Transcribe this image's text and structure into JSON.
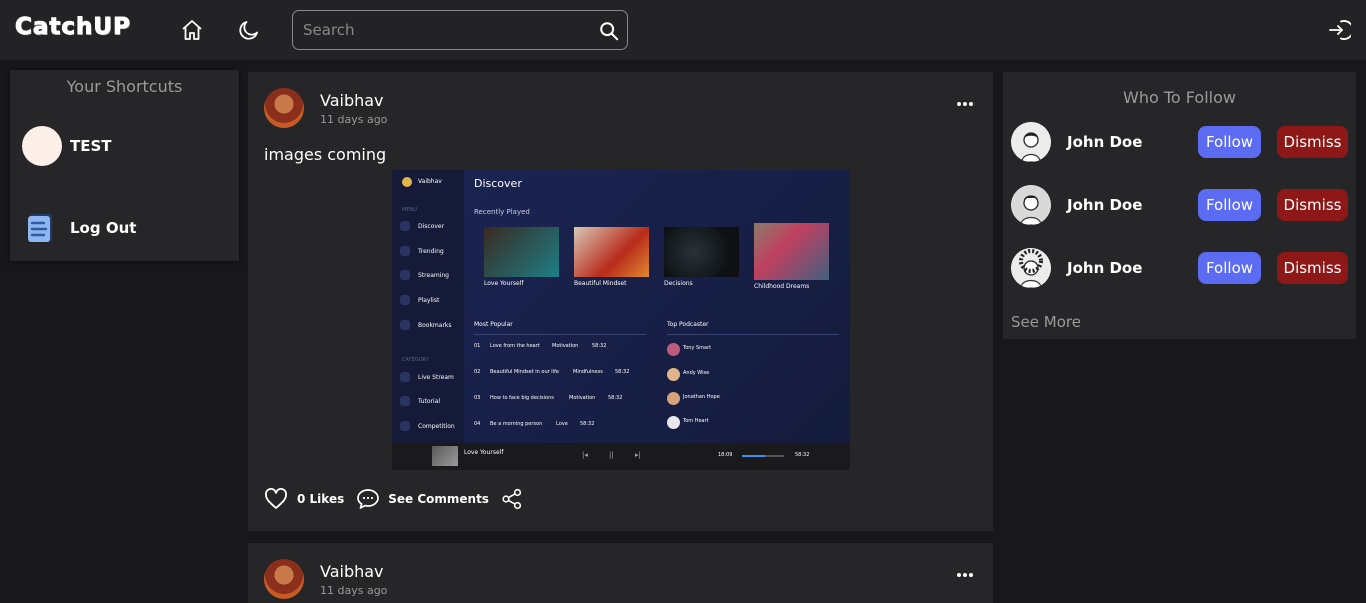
{
  "header": {
    "logo": "CatchUP",
    "search_placeholder": "Search"
  },
  "shortcuts": {
    "title": "Your Shortcuts",
    "items": [
      {
        "label": "TEST",
        "icon": "group-avatar"
      },
      {
        "label": "Log Out",
        "icon": "logout-doc-icon"
      }
    ]
  },
  "posts": [
    {
      "author": "Vaibhav",
      "time": "11 days ago",
      "text": "images coming",
      "likes_label": "0 Likes",
      "comments_label": "See Comments",
      "image": {
        "user": "Vaibhav",
        "heading": "Discover",
        "recently_played_label": "Recently Played",
        "menu_section": "MENU",
        "menu": [
          "Discover",
          "Trending",
          "Streaming",
          "Playlist",
          "Bookmarks"
        ],
        "category_section": "CATEGORY",
        "categories": [
          "Live Stream",
          "Tutorial",
          "Competition"
        ],
        "albums": [
          "Love Yourself",
          "Beautiful Mindset",
          "Decisions",
          "Childhood Dreams"
        ],
        "most_popular_label": "Most Popular",
        "popular": [
          {
            "no": "01",
            "title": "Love from the heart",
            "tag": "Motivation",
            "time": "58:32"
          },
          {
            "no": "02",
            "title": "Beautiful Mindset in our life",
            "tag": "Mindfulness",
            "time": "58:32"
          },
          {
            "no": "03",
            "title": "How to face big decisions",
            "tag": "Motivation",
            "time": "58:32"
          },
          {
            "no": "04",
            "title": "Be a morning person",
            "tag": "Love",
            "time": "58:32"
          }
        ],
        "top_podcaster_label": "Top Podcaster",
        "podcasters": [
          "Tony Smart",
          "Andy Wise",
          "Jonathan Hope",
          "Tom Heart"
        ],
        "player_title": "Love Yourself",
        "player_elapsed": "18:09",
        "player_total": "58:32",
        "player_progress": 0.55
      }
    },
    {
      "author": "Vaibhav",
      "time": "11 days ago"
    }
  ],
  "who_to_follow": {
    "title": "Who To Follow",
    "people": [
      {
        "name": "John Doe",
        "follow": "Follow",
        "dismiss": "Dismiss"
      },
      {
        "name": "John Doe",
        "follow": "Follow",
        "dismiss": "Dismiss"
      },
      {
        "name": "John Doe",
        "follow": "Follow",
        "dismiss": "Dismiss"
      }
    ],
    "see_more": "See More"
  },
  "colors": {
    "background": "#18181a",
    "panel": "#262628",
    "follow": "#5b6cf3",
    "dismiss": "#8e1818"
  }
}
